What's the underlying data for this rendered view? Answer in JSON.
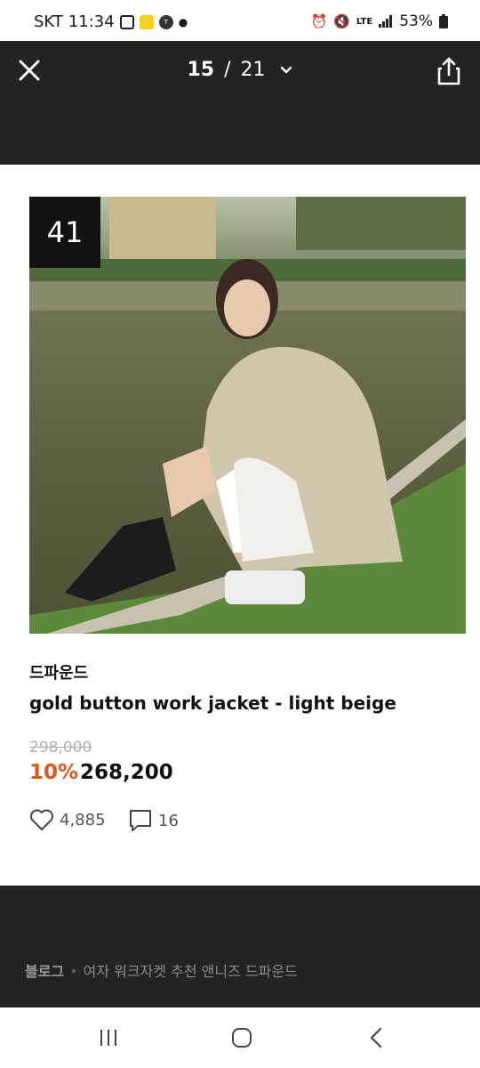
{
  "status_bar": {
    "carrier": "SKT",
    "time": "11:34",
    "network": "LTE",
    "battery": "53%"
  },
  "viewer": {
    "current": "15",
    "separator": "/",
    "total": "21"
  },
  "product": {
    "image_badge": "41",
    "brand": "드파운드",
    "name": "gold button work jacket - light beige",
    "original_price": "298,000",
    "discount": "10%",
    "price": "268,200",
    "likes": "4,885",
    "comments": "16"
  },
  "footer": {
    "source": "블로그",
    "separator": "•",
    "post_title": "여자 워크자켓 추천 앤니즈 드파운드"
  },
  "colors": {
    "dark_bg": "#232320",
    "discount": "#e0571d"
  }
}
